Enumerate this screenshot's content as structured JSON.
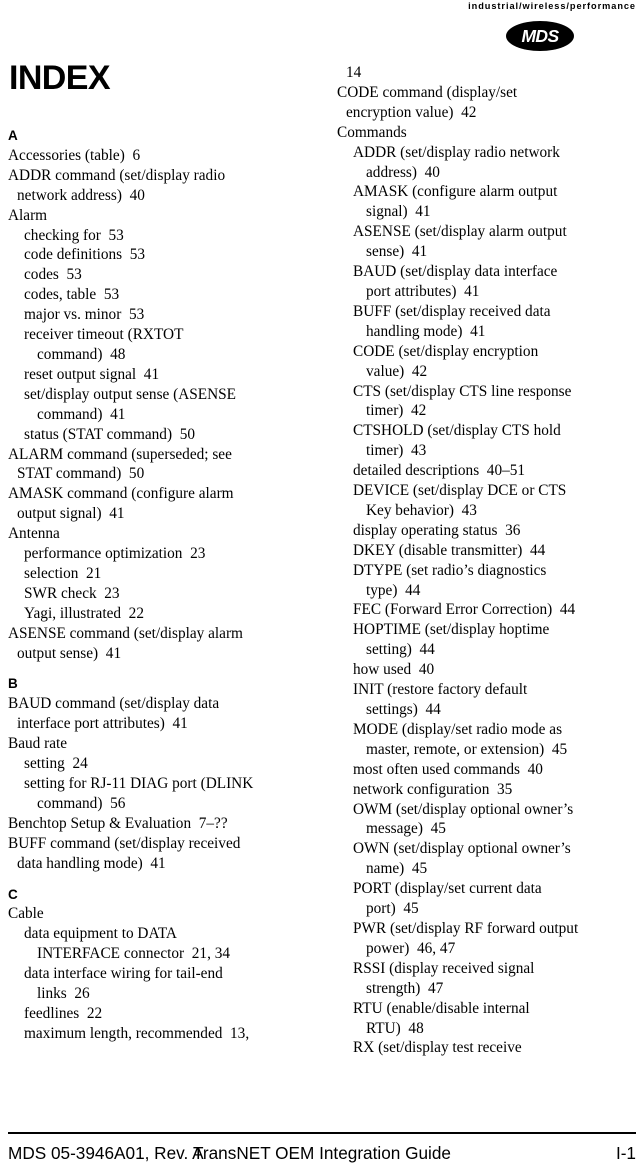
{
  "header": {
    "tagline": "industrial/wireless/performance",
    "logo_text": "MDS",
    "logo_name": "mds-logo"
  },
  "page_title": "INDEX",
  "columns": {
    "left": [
      {
        "kind": "letter",
        "text": "A"
      },
      {
        "kind": "entry",
        "level": 0,
        "text": "Accessories (table)  6"
      },
      {
        "kind": "entry",
        "level": 0,
        "text": "ADDR command (set/display radio"
      },
      {
        "kind": "entry",
        "level": "0c",
        "text": "network address)  40"
      },
      {
        "kind": "entry",
        "level": 0,
        "text": "Alarm"
      },
      {
        "kind": "entry",
        "level": 1,
        "text": "checking for  53"
      },
      {
        "kind": "entry",
        "level": 1,
        "text": "code definitions  53"
      },
      {
        "kind": "entry",
        "level": 1,
        "text": "codes  53"
      },
      {
        "kind": "entry",
        "level": 1,
        "text": "codes, table  53"
      },
      {
        "kind": "entry",
        "level": 1,
        "text": "major vs. minor  53"
      },
      {
        "kind": "entry",
        "level": 1,
        "text": "receiver timeout (RXTOT"
      },
      {
        "kind": "entry",
        "level": "1c",
        "text": "command)  48"
      },
      {
        "kind": "entry",
        "level": 1,
        "text": "reset output signal  41"
      },
      {
        "kind": "entry",
        "level": 1,
        "text": "set/display output sense (ASENSE"
      },
      {
        "kind": "entry",
        "level": "1c",
        "text": "command)  41"
      },
      {
        "kind": "entry",
        "level": 1,
        "text": "status (STAT command)  50"
      },
      {
        "kind": "entry",
        "level": 0,
        "text": "ALARM command (superseded; see"
      },
      {
        "kind": "entry",
        "level": "0c",
        "text": "STAT command)  50"
      },
      {
        "kind": "entry",
        "level": 0,
        "text": "AMASK command (configure alarm"
      },
      {
        "kind": "entry",
        "level": "0c",
        "text": "output signal)  41"
      },
      {
        "kind": "entry",
        "level": 0,
        "text": "Antenna"
      },
      {
        "kind": "entry",
        "level": 1,
        "text": "performance optimization  23"
      },
      {
        "kind": "entry",
        "level": 1,
        "text": "selection  21"
      },
      {
        "kind": "entry",
        "level": 1,
        "text": "SWR check  23"
      },
      {
        "kind": "entry",
        "level": 1,
        "text": "Yagi, illustrated  22"
      },
      {
        "kind": "entry",
        "level": 0,
        "text": "ASENSE command (set/display alarm"
      },
      {
        "kind": "entry",
        "level": "0c",
        "text": "output sense)  41"
      },
      {
        "kind": "letter",
        "text": "B"
      },
      {
        "kind": "entry",
        "level": 0,
        "text": "BAUD command (set/display data"
      },
      {
        "kind": "entry",
        "level": "0c",
        "text": "interface port attributes)  41"
      },
      {
        "kind": "entry",
        "level": 0,
        "text": "Baud rate"
      },
      {
        "kind": "entry",
        "level": 1,
        "text": "setting  24"
      },
      {
        "kind": "entry",
        "level": 1,
        "text": "setting for RJ-11 DIAG port (DLINK"
      },
      {
        "kind": "entry",
        "level": "1c",
        "text": "command)  56"
      },
      {
        "kind": "entry",
        "level": 0,
        "text": "Benchtop Setup & Evaluation  7–??"
      },
      {
        "kind": "entry",
        "level": 0,
        "text": "BUFF command (set/display received"
      },
      {
        "kind": "entry",
        "level": "0c",
        "text": "data handling mode)  41"
      },
      {
        "kind": "letter",
        "text": "C"
      },
      {
        "kind": "entry",
        "level": 0,
        "text": "Cable"
      },
      {
        "kind": "entry",
        "level": 1,
        "text": "data equipment to DATA"
      },
      {
        "kind": "entry",
        "level": "1c",
        "text": "INTERFACE connector  21, 34"
      },
      {
        "kind": "entry",
        "level": 1,
        "text": "data interface wiring for tail-end"
      },
      {
        "kind": "entry",
        "level": "1c",
        "text": "links  26"
      },
      {
        "kind": "entry",
        "level": 1,
        "text": "feedlines  22"
      },
      {
        "kind": "entry",
        "level": 1,
        "text": "maximum length, recommended  13,"
      }
    ],
    "right": [
      {
        "kind": "entry",
        "level": "0c",
        "text": "14"
      },
      {
        "kind": "entry",
        "level": 0,
        "text": "CODE command (display/set"
      },
      {
        "kind": "entry",
        "level": "0c",
        "text": "encryption value)  42"
      },
      {
        "kind": "entry",
        "level": 0,
        "text": "Commands"
      },
      {
        "kind": "entry",
        "level": 1,
        "text": "ADDR (set/display radio network"
      },
      {
        "kind": "entry",
        "level": "1c",
        "text": "address)  40"
      },
      {
        "kind": "entry",
        "level": 1,
        "text": "AMASK (configure alarm output"
      },
      {
        "kind": "entry",
        "level": "1c",
        "text": "signal)  41"
      },
      {
        "kind": "entry",
        "level": 1,
        "text": "ASENSE (set/display alarm output"
      },
      {
        "kind": "entry",
        "level": "1c",
        "text": "sense)  41"
      },
      {
        "kind": "entry",
        "level": 1,
        "text": "BAUD (set/display data interface"
      },
      {
        "kind": "entry",
        "level": "1c",
        "text": "port attributes)  41"
      },
      {
        "kind": "entry",
        "level": 1,
        "text": "BUFF (set/display received data"
      },
      {
        "kind": "entry",
        "level": "1c",
        "text": "handling mode)  41"
      },
      {
        "kind": "entry",
        "level": 1,
        "text": "CODE (set/display encryption"
      },
      {
        "kind": "entry",
        "level": "1c",
        "text": "value)  42"
      },
      {
        "kind": "entry",
        "level": 1,
        "text": "CTS (set/display CTS line response"
      },
      {
        "kind": "entry",
        "level": "1c",
        "text": "timer)  42"
      },
      {
        "kind": "entry",
        "level": 1,
        "text": "CTSHOLD (set/display CTS hold"
      },
      {
        "kind": "entry",
        "level": "1c",
        "text": "timer)  43"
      },
      {
        "kind": "entry",
        "level": 1,
        "text": "detailed descriptions  40–51"
      },
      {
        "kind": "entry",
        "level": 1,
        "text": "DEVICE (set/display DCE or CTS"
      },
      {
        "kind": "entry",
        "level": "1c",
        "text": "Key behavior)  43"
      },
      {
        "kind": "entry",
        "level": 1,
        "text": "display operating status  36"
      },
      {
        "kind": "entry",
        "level": 1,
        "text": "DKEY (disable transmitter)  44"
      },
      {
        "kind": "entry",
        "level": 1,
        "text": "DTYPE (set radio’s diagnostics"
      },
      {
        "kind": "entry",
        "level": "1c",
        "text": "type)  44"
      },
      {
        "kind": "entry",
        "level": 1,
        "text": "FEC (Forward Error Correction)  44"
      },
      {
        "kind": "entry",
        "level": 1,
        "text": "HOPTIME (set/display hoptime"
      },
      {
        "kind": "entry",
        "level": "1c",
        "text": "setting)  44"
      },
      {
        "kind": "entry",
        "level": 1,
        "text": "how used  40"
      },
      {
        "kind": "entry",
        "level": 1,
        "text": "INIT (restore factory default"
      },
      {
        "kind": "entry",
        "level": "1c",
        "text": "settings)  44"
      },
      {
        "kind": "entry",
        "level": 1,
        "text": "MODE (display/set radio mode as"
      },
      {
        "kind": "entry",
        "level": "1c",
        "text": "master, remote, or extension)  45"
      },
      {
        "kind": "entry",
        "level": 1,
        "text": "most often used commands  40"
      },
      {
        "kind": "entry",
        "level": 1,
        "text": "network configuration  35"
      },
      {
        "kind": "entry",
        "level": 1,
        "text": "OWM (set/display optional owner’s"
      },
      {
        "kind": "entry",
        "level": "1c",
        "text": "message)  45"
      },
      {
        "kind": "entry",
        "level": 1,
        "text": "OWN (set/display optional owner’s"
      },
      {
        "kind": "entry",
        "level": "1c",
        "text": "name)  45"
      },
      {
        "kind": "entry",
        "level": 1,
        "text": "PORT (display/set current data"
      },
      {
        "kind": "entry",
        "level": "1c",
        "text": "port)  45"
      },
      {
        "kind": "entry",
        "level": 1,
        "text": "PWR (set/display RF forward output"
      },
      {
        "kind": "entry",
        "level": "1c",
        "text": "power)  46, 47"
      },
      {
        "kind": "entry",
        "level": 1,
        "text": "RSSI (display received signal"
      },
      {
        "kind": "entry",
        "level": "1c",
        "text": "strength)  47"
      },
      {
        "kind": "entry",
        "level": 1,
        "text": "RTU (enable/disable internal"
      },
      {
        "kind": "entry",
        "level": "1c",
        "text": "RTU)  48"
      },
      {
        "kind": "entry",
        "level": 1,
        "text": "RX (set/display test receive"
      }
    ]
  },
  "footer": {
    "left": "MDS 05-3946A01, Rev.  A",
    "center": "TransNET OEM Integration Guide",
    "right": "I-1"
  }
}
